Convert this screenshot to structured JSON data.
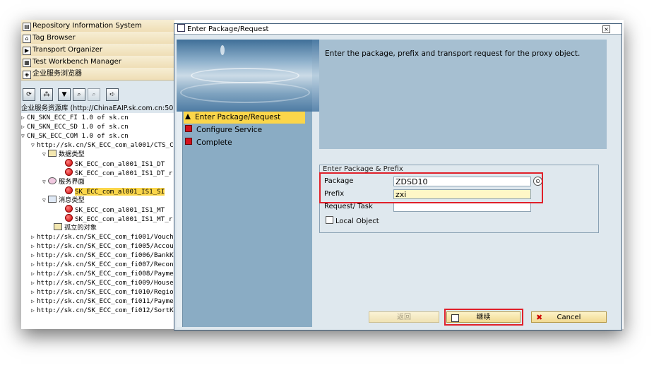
{
  "left_pane": {
    "menu_items": [
      {
        "label": "Repository Information System",
        "icon": "repository-icon"
      },
      {
        "label": "Tag Browser",
        "icon": "tag-icon"
      },
      {
        "label": "Transport Organizer",
        "icon": "transport-icon"
      },
      {
        "label": "Test Workbench Manager",
        "icon": "test-icon"
      },
      {
        "label": "企业服务浏览器",
        "icon": "enterprise-icon"
      }
    ],
    "tree_header": "企业服务资源库 (http://ChinaEAIP.sk.com.cn:500",
    "tree_rows": [
      {
        "text": "CN_SKN_ECC_FI 1.0 of sk.cn"
      },
      {
        "text": "CN_SKN_ECC_SD 1.0 of sk.cn"
      },
      {
        "text": "CN_SK_ECC_COM 1.0 of sk.cn"
      },
      {
        "text": "http://sk.cn/SK_ECC_com_al001/CTS_Cha"
      },
      {
        "text": "数据类型"
      },
      {
        "text": "SK_ECC_com_al001_IS1_DT"
      },
      {
        "text": "SK_ECC_com_al001_IS1_DT_r"
      },
      {
        "text": "服务界面"
      },
      {
        "text": "SK_ECC_com_al001_IS1_SI"
      },
      {
        "text": "消息类型"
      },
      {
        "text": "SK_ECC_com_al001_IS1_MT"
      },
      {
        "text": "SK_ECC_com_al001_IS1_MT_r"
      },
      {
        "text": "孤立的对象"
      },
      {
        "text": "http://sk.cn/SK_ECC_com_fi001/Voucher_"
      },
      {
        "text": "http://sk.cn/SK_ECC_com_fi005/Account"
      },
      {
        "text": "http://sk.cn/SK_ECC_com_fi006/BankKey"
      },
      {
        "text": "http://sk.cn/SK_ECC_com_fi007/Reconcil"
      },
      {
        "text": "http://sk.cn/SK_ECC_com_fi008/Payment"
      },
      {
        "text": "http://sk.cn/SK_ECC_com_fi009/HouseBa"
      },
      {
        "text": "http://sk.cn/SK_ECC_com_fi010/RegionCo"
      },
      {
        "text": "http://sk.cn/SK_ECC_com_fi011/Payment"
      },
      {
        "text": "http://sk.cn/SK_ECC_com_fi012/SortKey"
      }
    ]
  },
  "dialog": {
    "title": "Enter Package/Request",
    "steps": [
      {
        "label": "Enter Package/Request"
      },
      {
        "label": "Configure Service"
      },
      {
        "label": "Complete"
      }
    ],
    "info_text": "Enter the package, prefix and transport request for the proxy object.",
    "group_title": "Enter Package & Prefix",
    "fields": {
      "package_label": "Package",
      "package_value": "ZDSD10",
      "prefix_label": "Prefix",
      "prefix_value": "zxi",
      "request_label": "Request/ Task",
      "request_value": "",
      "local_object_label": "Local Object"
    },
    "buttons": {
      "back_label": "返回",
      "continue_label": "继续",
      "cancel_label": "Cancel"
    }
  },
  "colors": {
    "highlight": "#fbd64a",
    "red_box": "#e0202a"
  }
}
